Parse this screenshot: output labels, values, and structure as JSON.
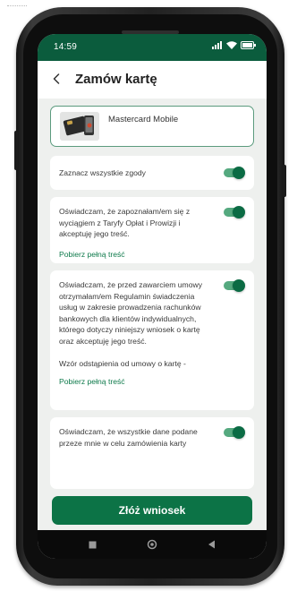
{
  "status_bar": {
    "time": "14:59",
    "icons": [
      "signal-icon",
      "wifi-icon",
      "battery-icon"
    ]
  },
  "header": {
    "back_icon": "chevron-left-icon",
    "title": "Zamów kartę"
  },
  "card": {
    "name": "Mastercard Mobile"
  },
  "consents": [
    {
      "text": "Zaznacz wszystkie zgody",
      "checked": true
    },
    {
      "text": "Oświadczam, że zapoznałam/em się z wyciągiem z Taryfy Opłat i Prowizji i akceptuję jego treść.",
      "link": "Pobierz pełną treść",
      "checked": true
    },
    {
      "text": "Oświadczam, że przed zawarciem umowy otrzymałam/em Regulamin świadczenia usług w zakresie prowadzenia rachunków bankowych dla klientów indywidualnych, którego dotyczy niniejszy wniosek o kartę oraz akceptuję jego treść.",
      "subtext": "Wzór odstąpienia od umowy o kartę -",
      "link": "Pobierz pełną treść",
      "checked": true
    },
    {
      "text": "Oświadczam, że wszystkie dane podane przeze mnie w celu zamówienia karty",
      "checked": true
    }
  ],
  "submit_label": "Złóż wniosek",
  "colors": {
    "accent": "#0c7346",
    "status_bar": "#0b5c3d",
    "link": "#0e7a4b"
  }
}
